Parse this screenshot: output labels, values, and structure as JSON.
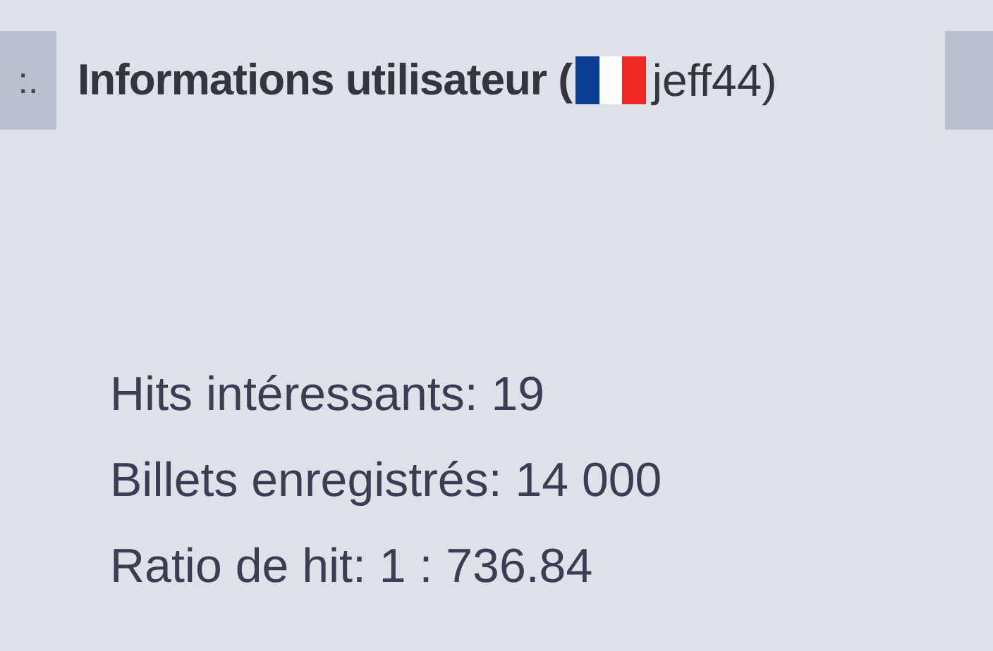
{
  "header": {
    "handle": ":.",
    "title": "Informations utilisateur (",
    "username": "jeff44)"
  },
  "stats": [
    "Hits intéressants: 19",
    "Billets enregistrés: 14 000",
    "Ratio de hit: 1 : 736.84"
  ]
}
